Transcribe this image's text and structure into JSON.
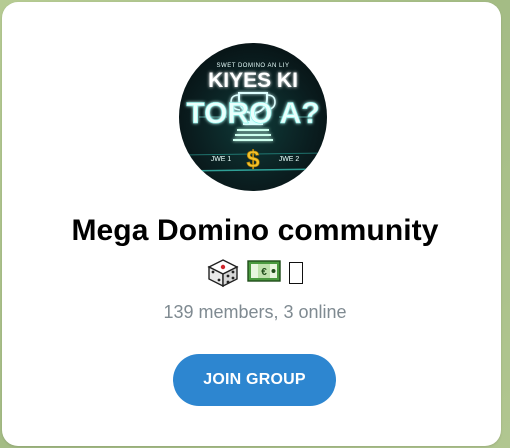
{
  "group": {
    "avatar": {
      "top_text": "SWET DOMINO AN LIY",
      "line1": "KIYES KI",
      "line2": "TORO A?",
      "left_label": "JWE 1",
      "right_label": "JWE 2",
      "currency_symbol": "$"
    },
    "name": "Mega Domino community",
    "emoji_icons": [
      "dice-icon",
      "money-icon",
      "missing-glyph-icon"
    ],
    "members_line": "139 members, 3 online",
    "join_label": "JOIN GROUP"
  },
  "colors": {
    "accent": "#2d86d0",
    "background": "#a9c08a",
    "subtitle": "#7f8a91",
    "neon": "#8ff6ee",
    "gold": "#f3c22a"
  }
}
